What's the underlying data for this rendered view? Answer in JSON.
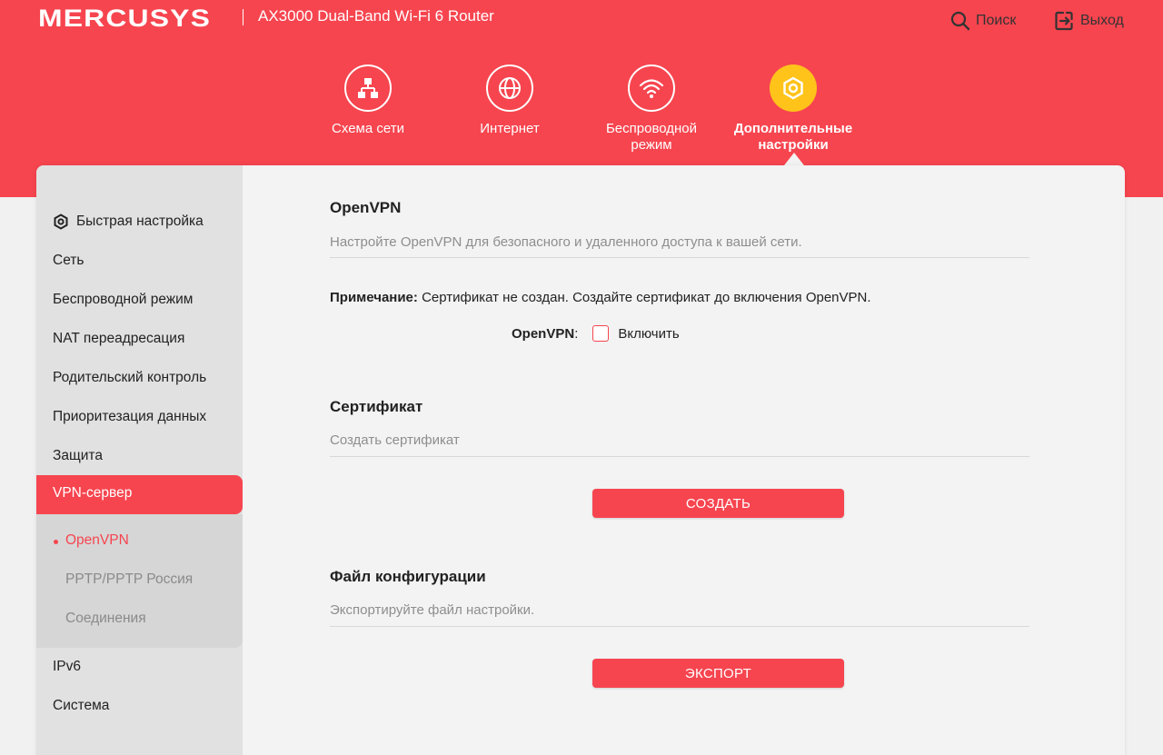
{
  "brand": {
    "logo": "MERCUSYS",
    "model": "AX3000 Dual-Band Wi-Fi 6 Router",
    "accent_color": "#f6454f",
    "active_nav_color": "#ffc31a"
  },
  "top_actions": {
    "search_label": "Поиск",
    "search_icon": "search-icon",
    "logout_label": "Выход",
    "logout_icon": "logout-icon"
  },
  "nav": {
    "items": [
      {
        "label": "Схема сети",
        "icon": "network-map-icon"
      },
      {
        "label": "Интернет",
        "icon": "globe-icon"
      },
      {
        "label": "Беспроводной\nрежим",
        "icon": "wifi-icon"
      },
      {
        "label": "Дополнительные\nнастройки",
        "icon": "gear-icon",
        "active": true
      }
    ]
  },
  "sidebar": {
    "items": [
      {
        "label": "Быстрая настройка",
        "icon": "gear-icon"
      },
      {
        "label": "Сеть"
      },
      {
        "label": "Беспроводной режим"
      },
      {
        "label": "NAT переадресация"
      },
      {
        "label": "Родительский контроль"
      },
      {
        "label": "Приоритезация данных"
      },
      {
        "label": "Защита"
      },
      {
        "label": "VPN-сервер",
        "active": true
      },
      {
        "label": "IPv6"
      },
      {
        "label": "Система"
      }
    ],
    "sub_items": [
      {
        "label": "OpenVPN",
        "current": true
      },
      {
        "label": "PPTP/PPTP Россия"
      },
      {
        "label": "Соединения"
      }
    ]
  },
  "openvpn": {
    "title": "OpenVPN",
    "subtitle": "Настройте OpenVPN для безопасного и удаленного доступа к вашей сети.",
    "note_label": "Примечание:",
    "note_text": " Сертификат не создан. Создайте сертификат до включения OpenVPN.",
    "field_label": "OpenVPN",
    "field_colon": ":",
    "enable_label": "Включить",
    "enabled": false
  },
  "certificate": {
    "title": "Сертификат",
    "subtitle": "Создать сертификат",
    "button": "СОЗДАТЬ"
  },
  "config_file": {
    "title": "Файл конфигурации",
    "subtitle": "Экспортируйте файл настройки.",
    "button": "ЭКСПОРТ"
  }
}
